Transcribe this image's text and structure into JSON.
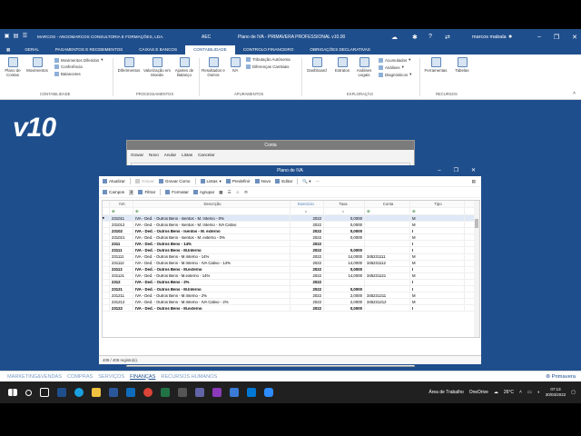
{
  "titlebar": {
    "company": "MARCOS - ANGOMARCOS CONSULTORIA E FORMAÇÕES, LDA.",
    "aec": "AEC",
    "app_title": "Plano de IVA - PRIMAVERA PROFESSIONAL v10.00",
    "user": "marcos mabala",
    "minimize": "–",
    "restore": "❐",
    "close": "✕"
  },
  "tabs": [
    "GERAL",
    "PAGAMENTOS E RECEBIMENTOS",
    "CAIXAS E BANCOS",
    "CONTABILIDADE",
    "CONTROLO FINANCEIRO",
    "OBRIGAÇÕES DECLARATIVAS"
  ],
  "active_tab": "CONTABILIDADE",
  "ribbon": {
    "plano_contas": "Plano de Contas",
    "movimentos": "Movimentos",
    "mov_diferidos": "Movimentos Diferidos",
    "conferencia": "Conferência",
    "balancetes": "Balancetes",
    "group_contabilidade": "CONTABILIDADE",
    "diferimentos": "Diferimentos",
    "valorizacao": "Valorização em Moeda",
    "ajustes": "Ajustes de Balanço",
    "group_processamentos": "PROCESSAMENTOS",
    "resultados": "Resultados e Outros",
    "iva": "IVA",
    "tributacao": "Tributação Autónoma",
    "diferencas": "Diferenças Cambiais",
    "group_apuramentos": "APURAMENTOS",
    "dashboard": "Dashboard",
    "extratos": "Extratos",
    "analises_legais": "Análises Legais",
    "acumulados": "Acumulados",
    "analises": "Análises",
    "diagnosticos": "Diagnósticos",
    "group_exploracao": "EXPLORAÇÃO",
    "ferramentas": "Ferramentas",
    "tabelas": "Tabelas",
    "group_recursos": "RECURSOS"
  },
  "logo": "v10",
  "conta_window": {
    "title": "Conta",
    "toolbar": [
      "Gravar",
      "Novo",
      "Anular",
      "Listas",
      "Cancelar"
    ]
  },
  "dialog": {
    "title": "Plano de IVA",
    "toolbar1": {
      "atualizar": "Atualizar",
      "gravar": "Gravar",
      "gravar_como": "Gravar Como",
      "listas": "Listas",
      "predefinir": "Predefinir",
      "novo": "Novo",
      "editar": "Editar"
    },
    "toolbar2": {
      "campos": "Campos",
      "filtrar": "Filtrar",
      "formatar": "Formatar",
      "agrupar": "Agrupar"
    },
    "columns": [
      "IVA",
      "Descrição",
      "Exercício",
      "Taxa",
      "Conta",
      "Tipo"
    ],
    "rows": [
      {
        "iva": "231011",
        "desc": "IVA - Ded. - Outros Bens - Isentos - M. Interno - 0%",
        "ex": "2022",
        "taxa": "0,0000",
        "conta": "",
        "tipo": "M",
        "bold": false
      },
      {
        "iva": "231012",
        "desc": "IVA - Ded. - Outros Bens - Isentos - M. Interno - IVA Cativo",
        "ex": "2022",
        "taxa": "0,0000",
        "conta": "",
        "tipo": "M",
        "bold": false
      },
      {
        "iva": "23102",
        "desc": "IVA - Ded. - Outros Bens - Isentos - M. externo",
        "ex": "2022",
        "taxa": "0,0000",
        "conta": "",
        "tipo": "I",
        "bold": true
      },
      {
        "iva": "231021",
        "desc": "IVA - Ded. - Outros Bens - Isentos - M. externo - 0%",
        "ex": "2022",
        "taxa": "0,0000",
        "conta": "",
        "tipo": "M",
        "bold": false
      },
      {
        "iva": "2311",
        "desc": "IVA - Ded. - Outros Bens - 14%",
        "ex": "2022",
        "taxa": "",
        "conta": "",
        "tipo": "I",
        "bold": true
      },
      {
        "iva": "23111",
        "desc": "IVA - Ded. - Outros Bens - M.Interno",
        "ex": "2022",
        "taxa": "0,0000",
        "conta": "",
        "tipo": "I",
        "bold": true
      },
      {
        "iva": "231111",
        "desc": "IVA - Ded. - Outros Bens - M.Interno - 14%",
        "ex": "2022",
        "taxa": "14,0000",
        "conta": "345231111",
        "tipo": "M",
        "bold": false
      },
      {
        "iva": "231112",
        "desc": "IVA - Ded. - Outros Bens - M.Interno - IVA Cativo - 14%",
        "ex": "2022",
        "taxa": "14,0000",
        "conta": "345231112",
        "tipo": "M",
        "bold": false
      },
      {
        "iva": "23112",
        "desc": "IVA - Ded. - Outros Bens - M.externo",
        "ex": "2022",
        "taxa": "0,0000",
        "conta": "",
        "tipo": "I",
        "bold": true
      },
      {
        "iva": "231121",
        "desc": "IVA - Ded. - Outros Bens - M.externo - 14%",
        "ex": "2022",
        "taxa": "14,0000",
        "conta": "345231121",
        "tipo": "M",
        "bold": false
      },
      {
        "iva": "2312",
        "desc": "IVA - Ded. - Outros Bens - 2%",
        "ex": "2022",
        "taxa": "",
        "conta": "",
        "tipo": "I",
        "bold": true
      },
      {
        "iva": "23121",
        "desc": "IVA - Ded. - Outros Bens - M.Interno",
        "ex": "2022",
        "taxa": "0,0000",
        "conta": "",
        "tipo": "I",
        "bold": true
      },
      {
        "iva": "231211",
        "desc": "IVA - Ded. - Outros Bens - M.Interno - 2%",
        "ex": "2022",
        "taxa": "2,0000",
        "conta": "345231211",
        "tipo": "M",
        "bold": false
      },
      {
        "iva": "231212",
        "desc": "IVA - Ded. - Outros Bens - M.Interno - IVA Cativo - 2%",
        "ex": "2022",
        "taxa": "2,0000",
        "conta": "345231212",
        "tipo": "M",
        "bold": false
      },
      {
        "iva": "23122",
        "desc": "IVA - Ded. - Outros Bens - M.externo",
        "ex": "2022",
        "taxa": "0,0000",
        "conta": "",
        "tipo": "I",
        "bold": true
      }
    ],
    "status": "409 / 409 registo(s)."
  },
  "modules": [
    "MARKETING&VENDAS",
    "COMPRAS",
    "SERVIÇOS",
    "FINANÇAS",
    "RECURSOS HUMANOS"
  ],
  "active_module": "FINANÇAS",
  "brand": "Primavera",
  "taskbar": {
    "area_trabalho": "Área de Trabalho",
    "onedrive": "OneDrive",
    "temp": "26°C",
    "time": "07:13",
    "date": "30/03/2022"
  },
  "colors": {
    "primary": "#1f4e8c",
    "taskbar": "#202020"
  }
}
